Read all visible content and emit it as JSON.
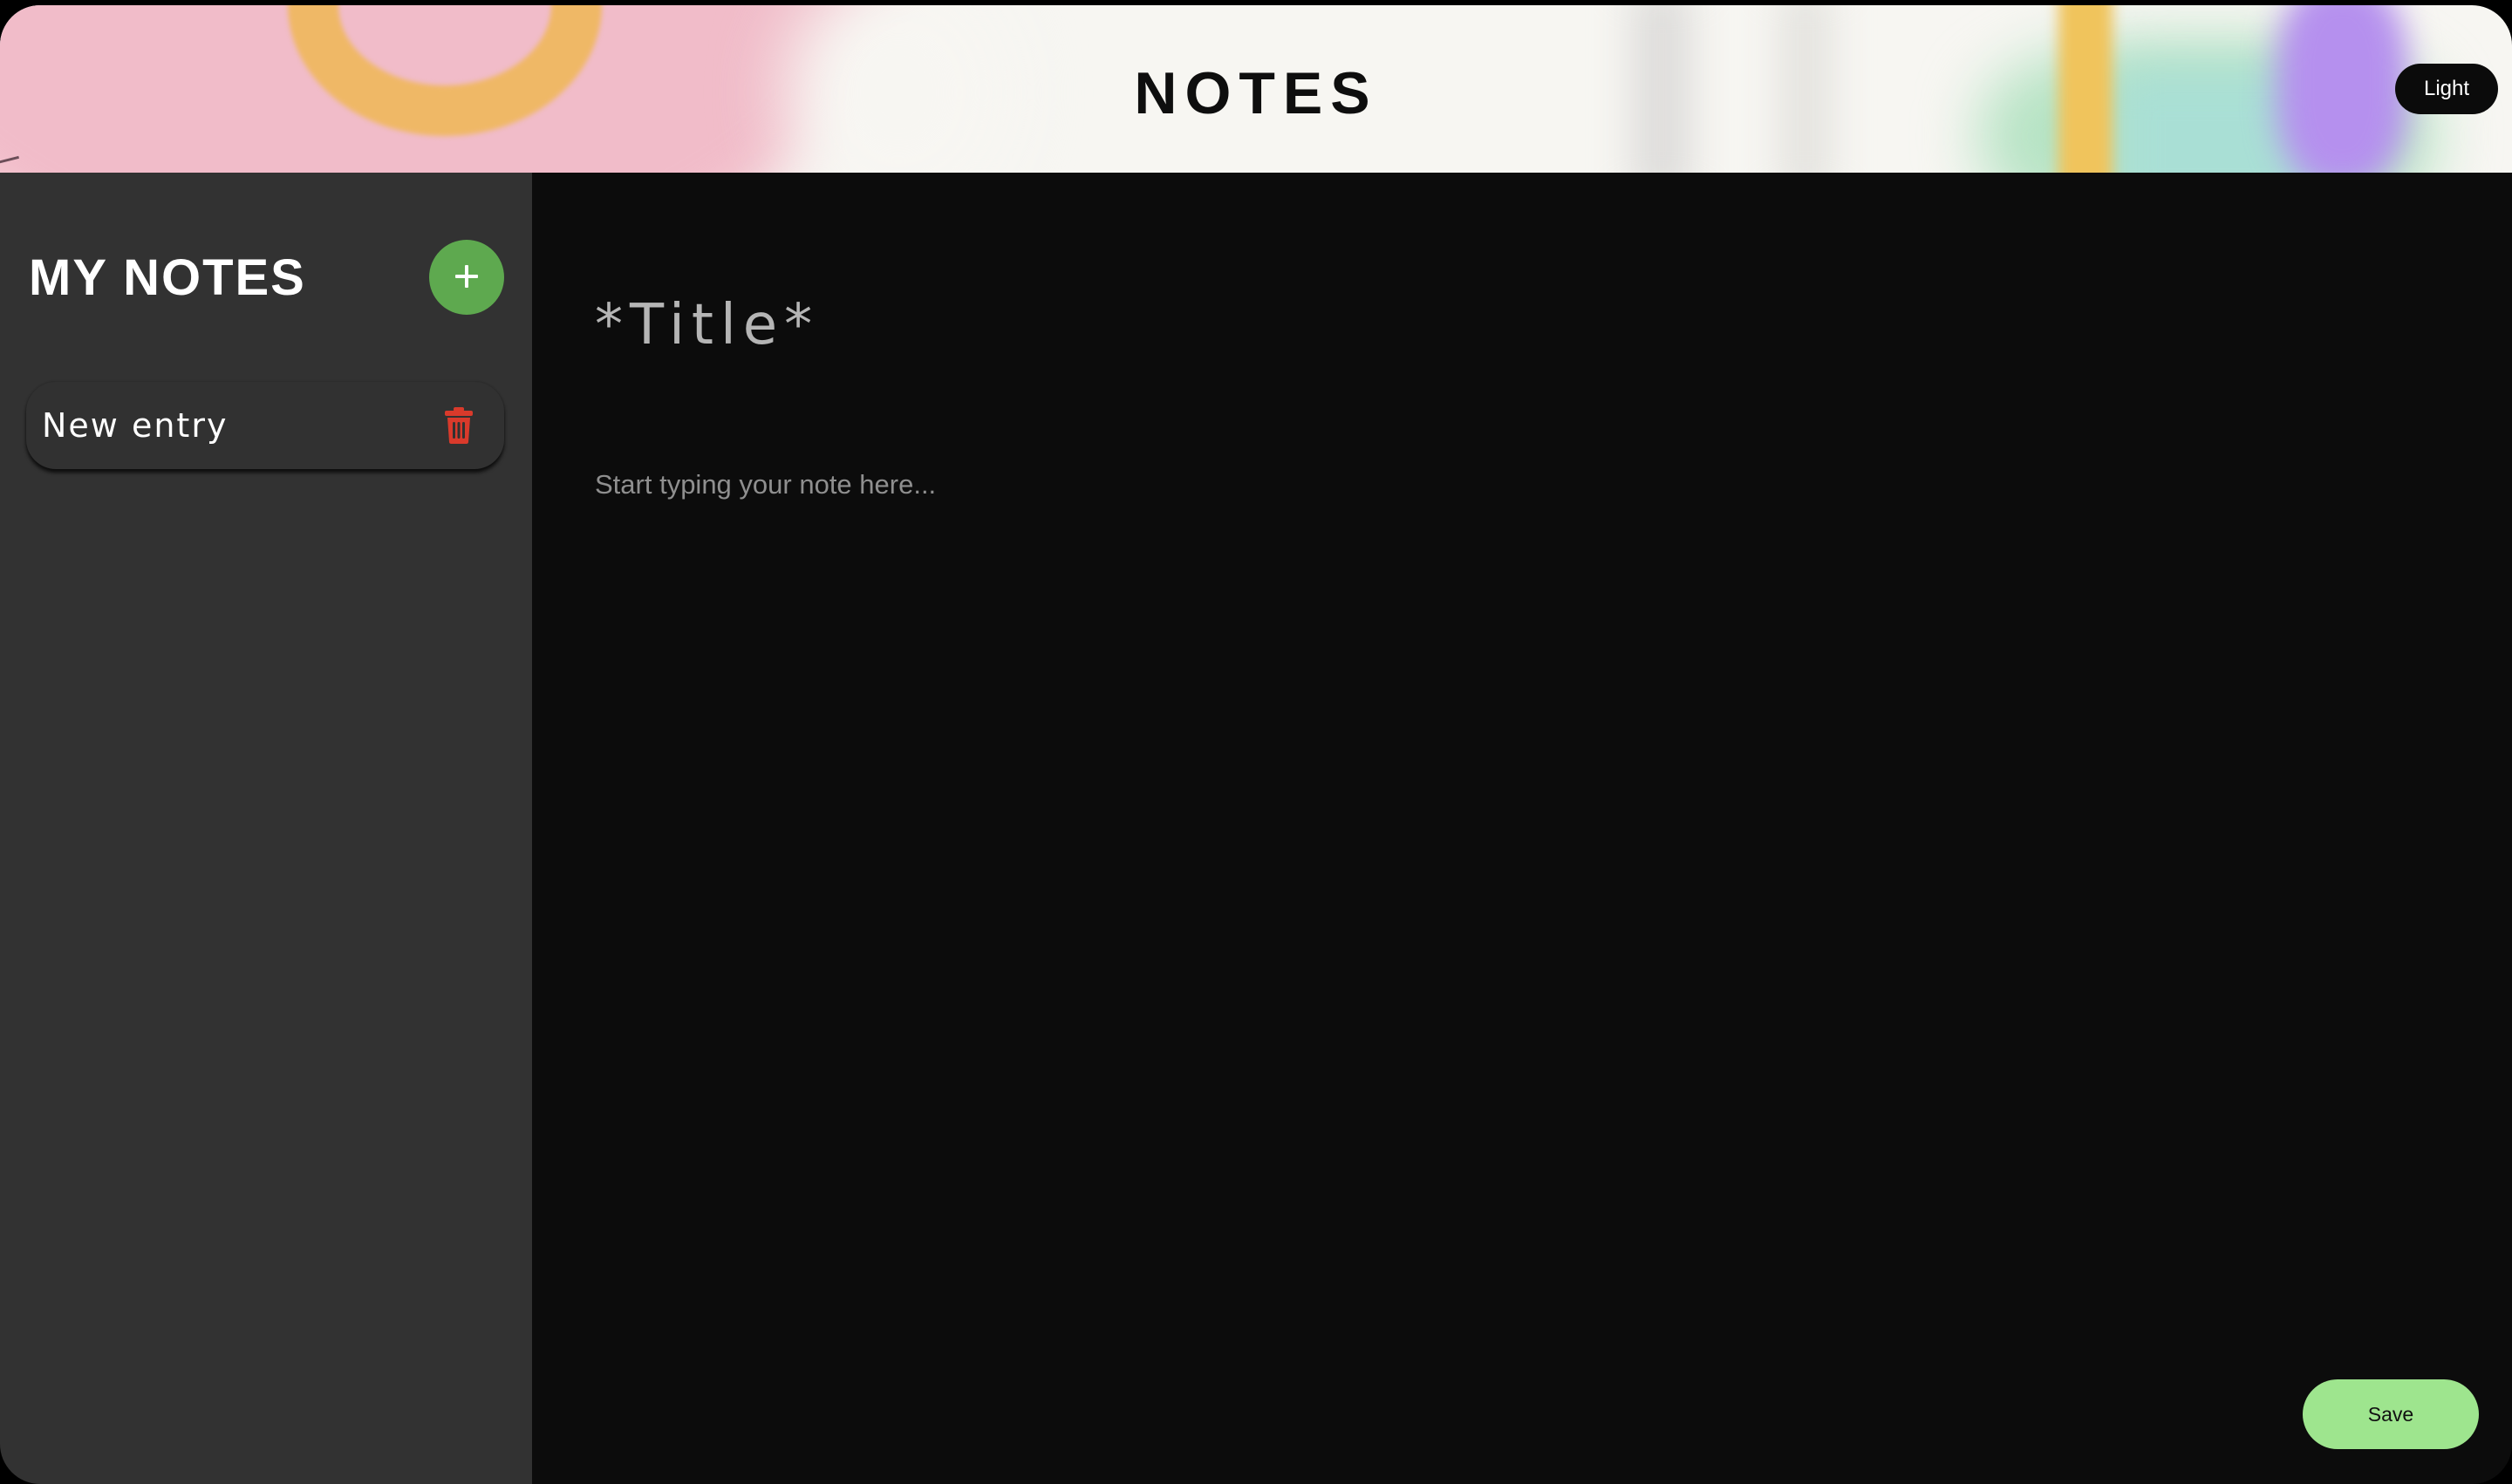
{
  "header": {
    "title": "NOTES",
    "theme_toggle_label": "Light"
  },
  "sidebar": {
    "title": "MY NOTES",
    "add_icon": "plus-icon",
    "notes": [
      {
        "label": "New entry",
        "delete_icon": "trash-icon"
      }
    ]
  },
  "editor": {
    "title_placeholder": "*Title*",
    "title_value": "",
    "body_placeholder": "Start typing your note here...",
    "body_value": "",
    "save_label": "Save"
  },
  "colors": {
    "accent_green": "#5ea94f",
    "save_green": "#9ee58e",
    "delete_red": "#d93a2b",
    "sidebar_bg": "#323232",
    "editor_bg": "#0c0c0c"
  }
}
